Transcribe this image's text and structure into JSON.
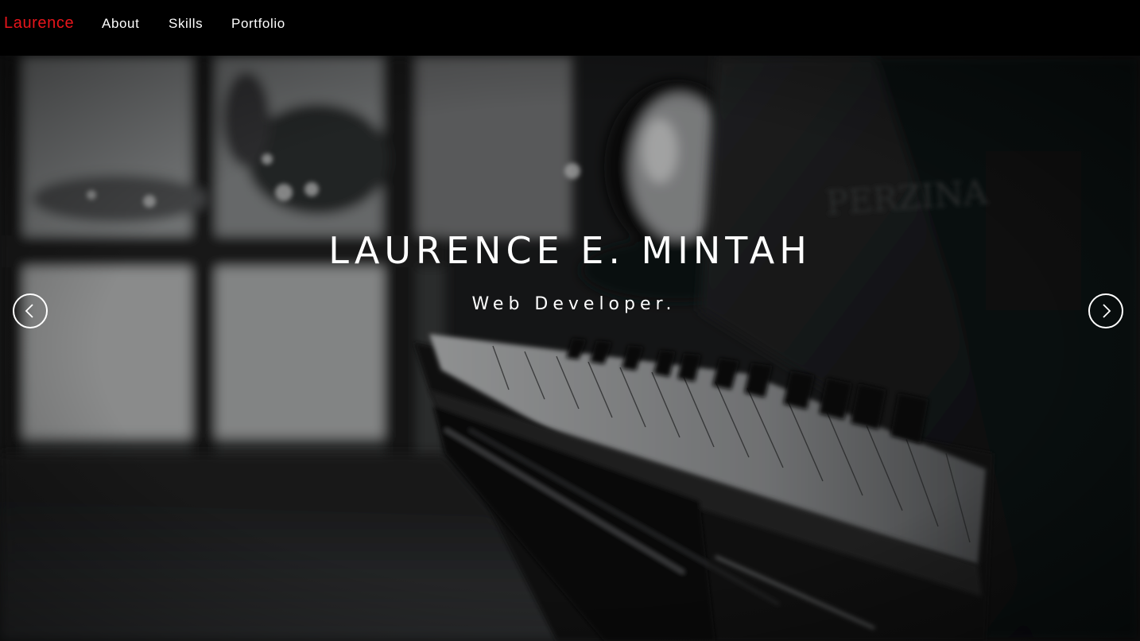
{
  "nav": {
    "brand": "Laurence",
    "links": [
      "About",
      "Skills",
      "Portfolio"
    ]
  },
  "hero": {
    "title": "LAURENCE E. MINTAH",
    "subtitle": "Web Developer.",
    "background": "black-and-white photo of a piano keyboard beside a window",
    "watermark_text": "PERZINA"
  },
  "carousel": {
    "prev_icon": "chevron-left-icon",
    "next_icon": "chevron-right-icon"
  },
  "colors": {
    "brand": "#e8151b",
    "nav_background": "#000000",
    "text": "#ffffff"
  }
}
